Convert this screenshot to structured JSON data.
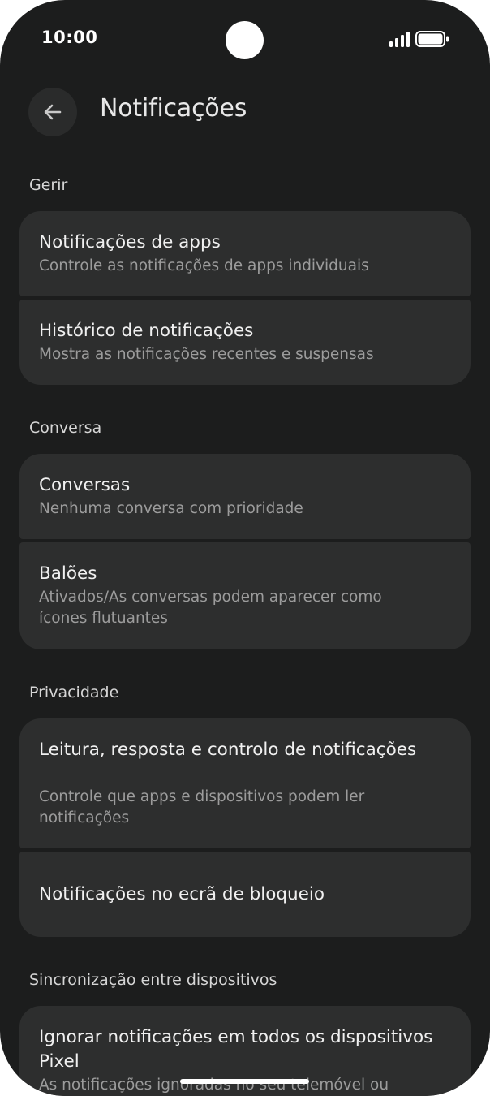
{
  "status_bar": {
    "time": "10:00",
    "signal_icon": "signal-bars-icon",
    "battery_icon": "battery-icon"
  },
  "header": {
    "back_icon": "arrow-back-icon",
    "title": "Notificações"
  },
  "sections": [
    {
      "label": "Gerir",
      "items": [
        {
          "title": "Notificações de apps",
          "subtitle": "Controle as notificações de apps individuais"
        },
        {
          "title": "Histórico de notificações",
          "subtitle": "Mostra as notificações recentes e suspensas"
        }
      ]
    },
    {
      "label": "Conversa",
      "items": [
        {
          "title": "Conversas",
          "subtitle": "Nenhuma conversa com prioridade"
        },
        {
          "title": "Balões",
          "subtitle": "Ativados/As conversas podem aparecer como ícones flutuantes"
        }
      ]
    },
    {
      "label": "Privacidade",
      "items": [
        {
          "title": "Leitura, resposta e controlo de notificações",
          "subtitle": "Controle que apps e dispositivos podem ler notificações"
        },
        {
          "title": "Notificações no ecrã de bloqueio",
          "subtitle": ""
        }
      ]
    },
    {
      "label": "Sincronização entre dispositivos",
      "items": [
        {
          "title": "Ignorar notificações em todos os dispositivos Pixel",
          "subtitle": "As notificações ignoradas no seu telemóvel ou"
        }
      ]
    }
  ],
  "colors": {
    "background": "#1c1d1d",
    "card": "#2d2e2e",
    "title_text": "#f0f0f0",
    "subtitle_text": "#9c9c9c"
  }
}
